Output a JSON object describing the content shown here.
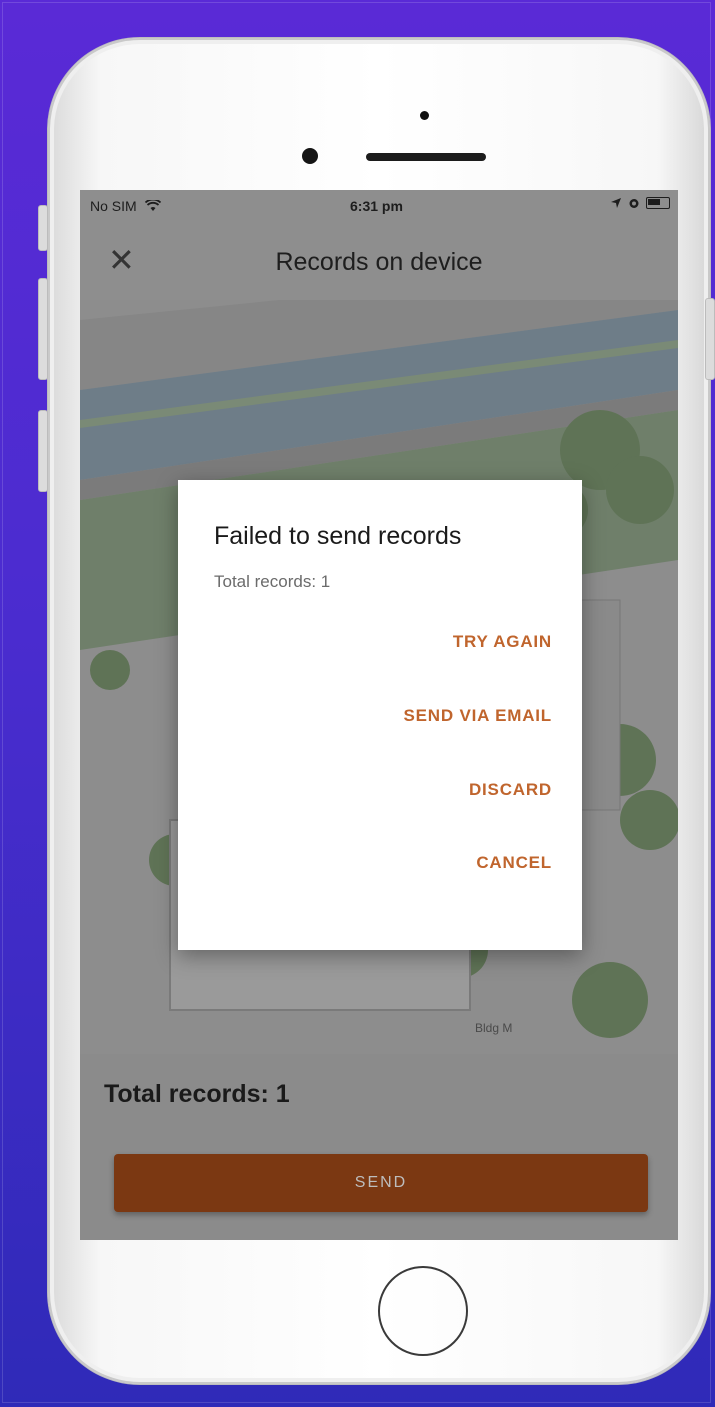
{
  "status_bar": {
    "carrier": "No SIM",
    "time": "6:31 pm"
  },
  "header": {
    "title": "Records on device",
    "close_icon": "close-icon"
  },
  "map": {
    "building_label": "Bldg M"
  },
  "dialog": {
    "title": "Failed to send records",
    "message": "Total records: 1",
    "actions": [
      {
        "label": "TRY AGAIN"
      },
      {
        "label": "SEND VIA EMAIL"
      },
      {
        "label": "DISCARD"
      },
      {
        "label": "CANCEL"
      }
    ]
  },
  "footer": {
    "total_label": "Total records: 1",
    "send_label": "SEND"
  },
  "colors": {
    "accent": "#c0652d",
    "send_button": "#7b3812",
    "background": "#4a2ccf"
  }
}
